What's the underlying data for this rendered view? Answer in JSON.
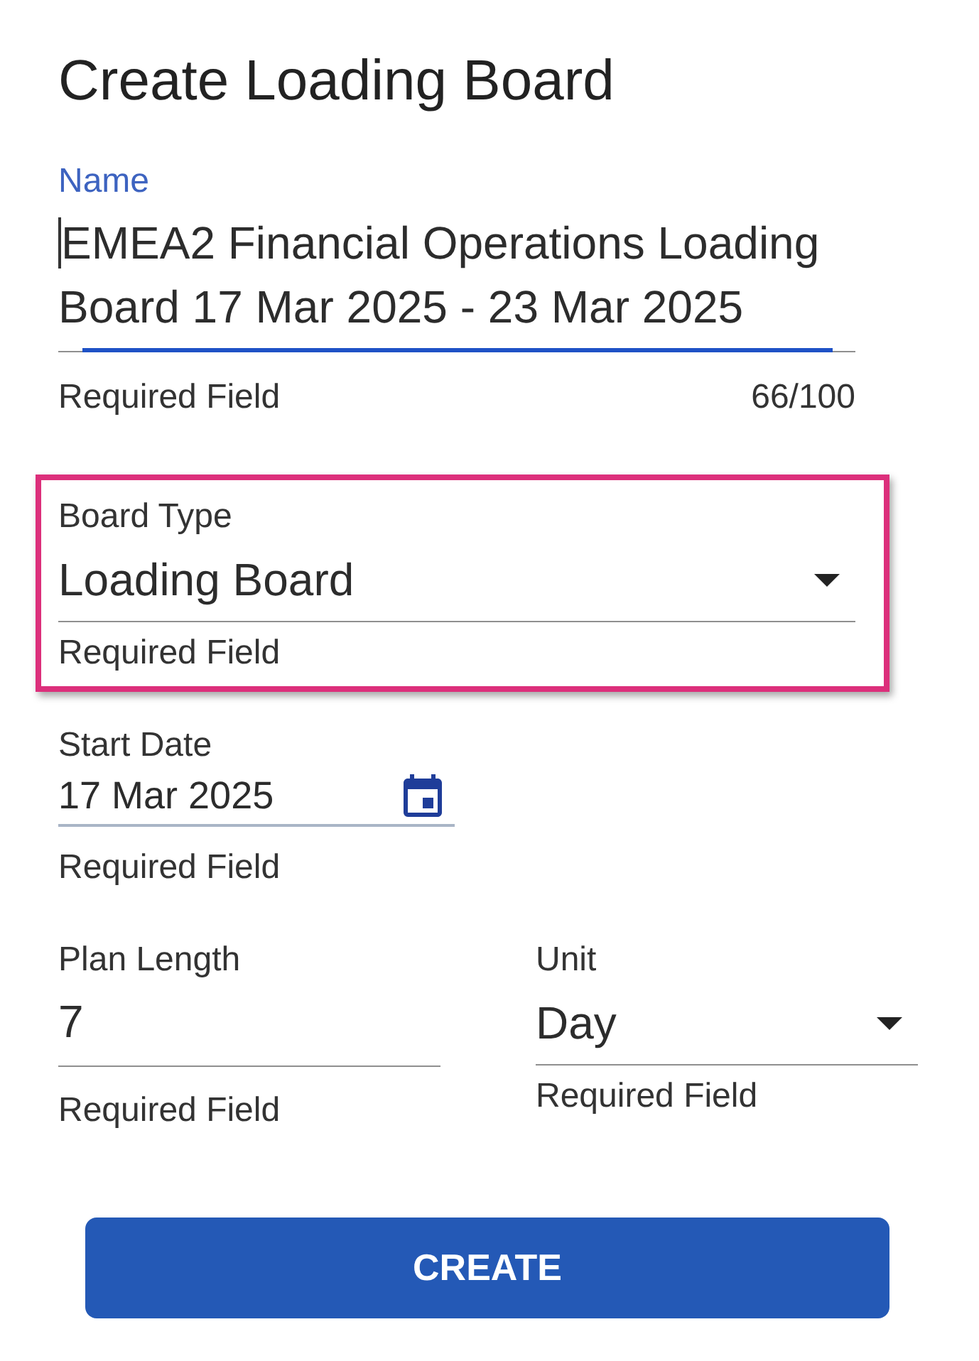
{
  "title": "Create Loading Board",
  "fields": [
    {
      "kind": "textarea",
      "label": "Name",
      "value": "EMEA2 Financial Operations Loading Board 17 Mar 2025 - 23 Mar 2025",
      "hint": "Required Field",
      "counter": "66/100",
      "focused": true,
      "highlighted": false
    },
    {
      "kind": "select",
      "label": "Board Type",
      "value": "Loading Board",
      "hint": "Required Field",
      "focused": false,
      "highlighted": true
    },
    {
      "kind": "date",
      "label": "Start Date",
      "value": "17 Mar 2025",
      "hint": "Required Field",
      "focused": false,
      "highlighted": false
    }
  ],
  "field_row": [
    {
      "kind": "number",
      "label": "Plan Length",
      "value": "7",
      "hint": "Required Field",
      "focused": false,
      "highlighted": false
    },
    {
      "kind": "select",
      "label": "Unit",
      "value": "Day",
      "hint": "Required Field",
      "focused": false,
      "highlighted": false
    }
  ],
  "button": {
    "label": "CREATE"
  }
}
